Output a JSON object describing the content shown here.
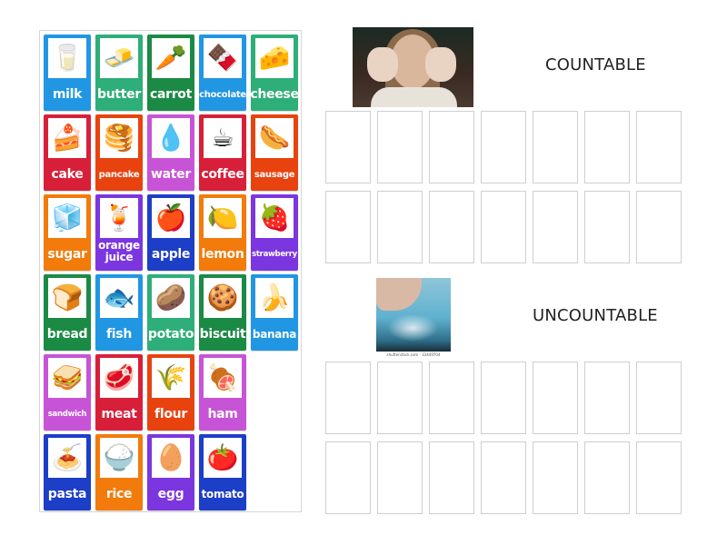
{
  "colors": {
    "blue": "#2196e3",
    "green": "#2eae78",
    "dark_green": "#1b8a45",
    "red": "#d81f3a",
    "orange_red": "#e8430f",
    "pink_purple": "#c754d6",
    "orange": "#f27b0c",
    "purple": "#7b36e0",
    "navy": "#1d3ec7",
    "slot_border": "#cfcfcf"
  },
  "cards": [
    {
      "label": "milk",
      "icon": "milk-bottle-icon",
      "glyph": "🥛",
      "color": "#2196e3",
      "size": ""
    },
    {
      "label": "butter",
      "icon": "butter-icon",
      "glyph": "🧈",
      "color": "#2eae78",
      "size": ""
    },
    {
      "label": "carrot",
      "icon": "carrot-icon",
      "glyph": "🥕",
      "color": "#1b8a45",
      "size": ""
    },
    {
      "label": "chocolate",
      "icon": "chocolate-icon",
      "glyph": "🍫",
      "color": "#2196e3",
      "size": "sm"
    },
    {
      "label": "cheese",
      "icon": "cheese-icon",
      "glyph": "🧀",
      "color": "#2eae78",
      "size": ""
    },
    {
      "label": "cake",
      "icon": "cake-icon",
      "glyph": "🍰",
      "color": "#d81f3a",
      "size": ""
    },
    {
      "label": "pancake",
      "icon": "pancake-icon",
      "glyph": "🥞",
      "color": "#e8430f",
      "size": "sm"
    },
    {
      "label": "water",
      "icon": "water-bottle-icon",
      "glyph": "💧",
      "color": "#c754d6",
      "size": ""
    },
    {
      "label": "coffee",
      "icon": "coffee-cup-icon",
      "glyph": "☕",
      "color": "#d81f3a",
      "size": ""
    },
    {
      "label": "sausage",
      "icon": "sausage-icon",
      "glyph": "🌭",
      "color": "#e8430f",
      "size": "sm"
    },
    {
      "label": "sugar",
      "icon": "sugar-cubes-icon",
      "glyph": "🧊",
      "color": "#f27b0c",
      "size": ""
    },
    {
      "label": "orange juice",
      "icon": "orange-juice-icon",
      "glyph": "🍹",
      "color": "#7b36e0",
      "size": "two"
    },
    {
      "label": "apple",
      "icon": "apple-icon",
      "glyph": "🍎",
      "color": "#1d3ec7",
      "size": ""
    },
    {
      "label": "lemon",
      "icon": "lemon-icon",
      "glyph": "🍋",
      "color": "#f27b0c",
      "size": ""
    },
    {
      "label": "strawberry",
      "icon": "strawberry-icon",
      "glyph": "🍓",
      "color": "#7b36e0",
      "size": "xs"
    },
    {
      "label": "bread",
      "icon": "bread-icon",
      "glyph": "🍞",
      "color": "#1b8a45",
      "size": ""
    },
    {
      "label": "fish",
      "icon": "fish-icon",
      "glyph": "🐟",
      "color": "#2196e3",
      "size": ""
    },
    {
      "label": "potato",
      "icon": "potato-icon",
      "glyph": "🥔",
      "color": "#2eae78",
      "size": ""
    },
    {
      "label": "biscuit",
      "icon": "biscuit-icon",
      "glyph": "🍪",
      "color": "#1b8a45",
      "size": ""
    },
    {
      "label": "banana",
      "icon": "banana-icon",
      "glyph": "🍌",
      "color": "#2196e3",
      "size": "sm2"
    },
    {
      "label": "sandwich",
      "icon": "sandwich-icon",
      "glyph": "🥪",
      "color": "#c754d6",
      "size": "xs"
    },
    {
      "label": "meat",
      "icon": "meat-steak-icon",
      "glyph": "🥩",
      "color": "#d81f3a",
      "size": ""
    },
    {
      "label": "flour",
      "icon": "flour-icon",
      "glyph": "🌾",
      "color": "#e8430f",
      "size": ""
    },
    {
      "label": "ham",
      "icon": "ham-icon",
      "glyph": "🍖",
      "color": "#c754d6",
      "size": ""
    },
    null,
    {
      "label": "pasta",
      "icon": "pasta-icon",
      "glyph": "🍝",
      "color": "#1d3ec7",
      "size": ""
    },
    {
      "label": "rice",
      "icon": "rice-bowl-icon",
      "glyph": "🍚",
      "color": "#f27b0c",
      "size": ""
    },
    {
      "label": "egg",
      "icon": "egg-icon",
      "glyph": "🥚",
      "color": "#7b36e0",
      "size": ""
    },
    {
      "label": "tomato",
      "icon": "tomato-icon",
      "glyph": "🍅",
      "color": "#1d3ec7",
      "size": "sm2"
    }
  ],
  "groups": [
    {
      "title": "COUNTABLE",
      "photo": "girl-counting-fingers-photo",
      "slot_rows": 2,
      "slot_cols": 7
    },
    {
      "title": "UNCOUNTABLE",
      "photo": "water-splash-photo",
      "photo_caption": "shutterstock.com · 33449704",
      "slot_rows": 2,
      "slot_cols": 7
    }
  ]
}
